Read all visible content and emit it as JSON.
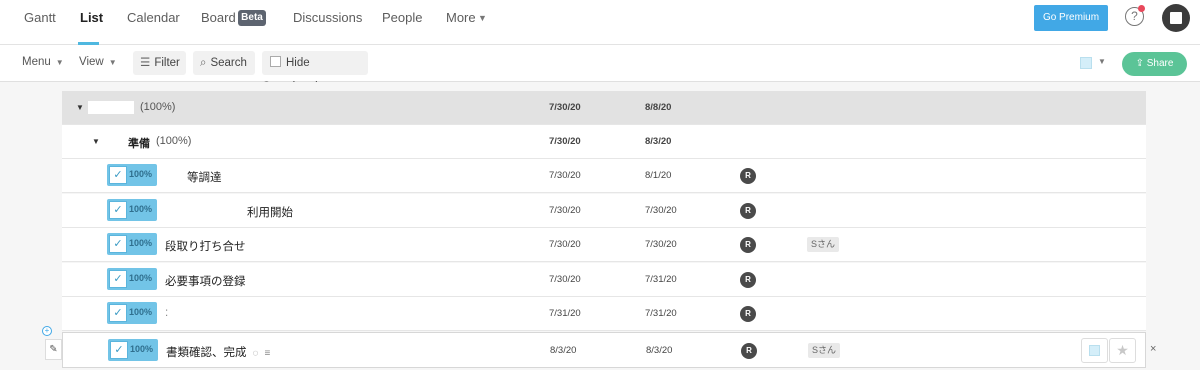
{
  "nav": {
    "tabs": [
      "Gantt",
      "List",
      "Calendar",
      "Board",
      "Discussions",
      "People",
      "More"
    ],
    "active_tab": "List",
    "beta_badge": "Beta",
    "more_caret": "▼",
    "premium_button": "Go Premium",
    "help_icon": "?"
  },
  "toolbar": {
    "menu": "Menu",
    "view": "View",
    "filter": "Filter",
    "search": "Search",
    "hide_completed": "Hide Completed",
    "share": "Share",
    "caret": "▼"
  },
  "list": {
    "group": {
      "percent": "(100%)",
      "start": "7/30/20",
      "end": "8/8/20"
    },
    "subgroup": {
      "name": "準備",
      "percent": "(100%)",
      "start": "7/30/20",
      "end": "8/3/20"
    },
    "tasks": [
      {
        "percent": "100%",
        "name": "等調達",
        "start": "7/30/20",
        "end": "8/1/20",
        "assignee": "R",
        "tag": ""
      },
      {
        "percent": "100%",
        "name": "利用開始",
        "start": "7/30/20",
        "end": "7/30/20",
        "assignee": "R",
        "tag": ""
      },
      {
        "percent": "100%",
        "name": "段取り打ち合せ",
        "start": "7/30/20",
        "end": "7/30/20",
        "assignee": "R",
        "tag": "Sさん"
      },
      {
        "percent": "100%",
        "name": "必要事項の登録",
        "start": "7/30/20",
        "end": "7/31/20",
        "assignee": "R",
        "tag": ""
      },
      {
        "percent": "100%",
        "name": ":",
        "start": "7/31/20",
        "end": "7/31/20",
        "assignee": "R",
        "tag": ""
      },
      {
        "percent": "100%",
        "name": "書類確認、完成",
        "start": "8/3/20",
        "end": "8/3/20",
        "assignee": "R",
        "tag": "Sさん"
      }
    ]
  },
  "colors": {
    "accent": "#41a8e6",
    "share": "#5bc497",
    "progress": "#72c4e7"
  }
}
